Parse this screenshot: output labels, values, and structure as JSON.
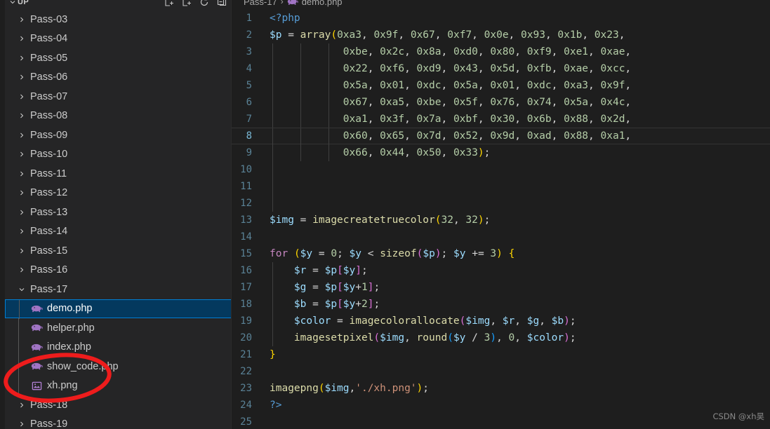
{
  "sidebar": {
    "header": {
      "title": "UP",
      "chevron_icon": "chevron-down-icon",
      "actions": [
        {
          "name": "new-file-icon",
          "tooltip": "New File"
        },
        {
          "name": "new-folder-icon",
          "tooltip": "New Folder"
        },
        {
          "name": "refresh-icon",
          "tooltip": "Refresh Explorer"
        },
        {
          "name": "collapse-all-icon",
          "tooltip": "Collapse Folders in Explorer"
        }
      ]
    },
    "tree": [
      {
        "label": "Pass-03",
        "type": "folder",
        "state": "collapsed"
      },
      {
        "label": "Pass-04",
        "type": "folder",
        "state": "collapsed"
      },
      {
        "label": "Pass-05",
        "type": "folder",
        "state": "collapsed"
      },
      {
        "label": "Pass-06",
        "type": "folder",
        "state": "collapsed"
      },
      {
        "label": "Pass-07",
        "type": "folder",
        "state": "collapsed"
      },
      {
        "label": "Pass-08",
        "type": "folder",
        "state": "collapsed"
      },
      {
        "label": "Pass-09",
        "type": "folder",
        "state": "collapsed"
      },
      {
        "label": "Pass-10",
        "type": "folder",
        "state": "collapsed"
      },
      {
        "label": "Pass-11",
        "type": "folder",
        "state": "collapsed"
      },
      {
        "label": "Pass-12",
        "type": "folder",
        "state": "collapsed"
      },
      {
        "label": "Pass-13",
        "type": "folder",
        "state": "collapsed"
      },
      {
        "label": "Pass-14",
        "type": "folder",
        "state": "collapsed"
      },
      {
        "label": "Pass-15",
        "type": "folder",
        "state": "collapsed"
      },
      {
        "label": "Pass-16",
        "type": "folder",
        "state": "collapsed"
      },
      {
        "label": "Pass-17",
        "type": "folder",
        "state": "expanded"
      },
      {
        "label": "demo.php",
        "type": "php-file",
        "selected": true
      },
      {
        "label": "helper.php",
        "type": "php-file",
        "selected": false
      },
      {
        "label": "index.php",
        "type": "php-file",
        "selected": false
      },
      {
        "label": "show_code.php",
        "type": "php-file",
        "selected": false
      },
      {
        "label": "xh.png",
        "type": "image-file",
        "selected": false
      },
      {
        "label": "Pass-18",
        "type": "folder",
        "state": "collapsed"
      },
      {
        "label": "Pass-19",
        "type": "folder",
        "state": "collapsed"
      }
    ]
  },
  "editor": {
    "breadcrumb": {
      "folder": "Pass-17",
      "separator": "›",
      "file": "demo.php",
      "file_icon": "php-elephant-icon"
    },
    "active_line": 8,
    "lines": [
      {
        "n": "1",
        "segs": [
          [
            "t-tag",
            "<?php"
          ]
        ]
      },
      {
        "n": "2",
        "segs": [
          [
            "t-var",
            "$p"
          ],
          [
            "t-op",
            " = "
          ],
          [
            "t-fn",
            "array"
          ],
          [
            "t-p1",
            "("
          ],
          [
            "t-num",
            "0xa3"
          ],
          [
            "t-op",
            ", "
          ],
          [
            "t-num",
            "0x9f"
          ],
          [
            "t-op",
            ", "
          ],
          [
            "t-num",
            "0x67"
          ],
          [
            "t-op",
            ", "
          ],
          [
            "t-num",
            "0xf7"
          ],
          [
            "t-op",
            ", "
          ],
          [
            "t-num",
            "0x0e"
          ],
          [
            "t-op",
            ", "
          ],
          [
            "t-num",
            "0x93"
          ],
          [
            "t-op",
            ", "
          ],
          [
            "t-num",
            "0x1b"
          ],
          [
            "t-op",
            ", "
          ],
          [
            "t-num",
            "0x23"
          ],
          [
            "t-op",
            ","
          ]
        ]
      },
      {
        "n": "3",
        "segs": [
          [
            "t-plain",
            "            "
          ],
          [
            "t-num",
            "0xbe"
          ],
          [
            "t-op",
            ", "
          ],
          [
            "t-num",
            "0x2c"
          ],
          [
            "t-op",
            ", "
          ],
          [
            "t-num",
            "0x8a"
          ],
          [
            "t-op",
            ", "
          ],
          [
            "t-num",
            "0xd0"
          ],
          [
            "t-op",
            ", "
          ],
          [
            "t-num",
            "0x80"
          ],
          [
            "t-op",
            ", "
          ],
          [
            "t-num",
            "0xf9"
          ],
          [
            "t-op",
            ", "
          ],
          [
            "t-num",
            "0xe1"
          ],
          [
            "t-op",
            ", "
          ],
          [
            "t-num",
            "0xae"
          ],
          [
            "t-op",
            ","
          ]
        ]
      },
      {
        "n": "4",
        "segs": [
          [
            "t-plain",
            "            "
          ],
          [
            "t-num",
            "0x22"
          ],
          [
            "t-op",
            ", "
          ],
          [
            "t-num",
            "0xf6"
          ],
          [
            "t-op",
            ", "
          ],
          [
            "t-num",
            "0xd9"
          ],
          [
            "t-op",
            ", "
          ],
          [
            "t-num",
            "0x43"
          ],
          [
            "t-op",
            ", "
          ],
          [
            "t-num",
            "0x5d"
          ],
          [
            "t-op",
            ", "
          ],
          [
            "t-num",
            "0xfb"
          ],
          [
            "t-op",
            ", "
          ],
          [
            "t-num",
            "0xae"
          ],
          [
            "t-op",
            ", "
          ],
          [
            "t-num",
            "0xcc"
          ],
          [
            "t-op",
            ","
          ]
        ]
      },
      {
        "n": "5",
        "segs": [
          [
            "t-plain",
            "            "
          ],
          [
            "t-num",
            "0x5a"
          ],
          [
            "t-op",
            ", "
          ],
          [
            "t-num",
            "0x01"
          ],
          [
            "t-op",
            ", "
          ],
          [
            "t-num",
            "0xdc"
          ],
          [
            "t-op",
            ", "
          ],
          [
            "t-num",
            "0x5a"
          ],
          [
            "t-op",
            ", "
          ],
          [
            "t-num",
            "0x01"
          ],
          [
            "t-op",
            ", "
          ],
          [
            "t-num",
            "0xdc"
          ],
          [
            "t-op",
            ", "
          ],
          [
            "t-num",
            "0xa3"
          ],
          [
            "t-op",
            ", "
          ],
          [
            "t-num",
            "0x9f"
          ],
          [
            "t-op",
            ","
          ]
        ]
      },
      {
        "n": "6",
        "segs": [
          [
            "t-plain",
            "            "
          ],
          [
            "t-num",
            "0x67"
          ],
          [
            "t-op",
            ", "
          ],
          [
            "t-num",
            "0xa5"
          ],
          [
            "t-op",
            ", "
          ],
          [
            "t-num",
            "0xbe"
          ],
          [
            "t-op",
            ", "
          ],
          [
            "t-num",
            "0x5f"
          ],
          [
            "t-op",
            ", "
          ],
          [
            "t-num",
            "0x76"
          ],
          [
            "t-op",
            ", "
          ],
          [
            "t-num",
            "0x74"
          ],
          [
            "t-op",
            ", "
          ],
          [
            "t-num",
            "0x5a"
          ],
          [
            "t-op",
            ", "
          ],
          [
            "t-num",
            "0x4c"
          ],
          [
            "t-op",
            ","
          ]
        ]
      },
      {
        "n": "7",
        "segs": [
          [
            "t-plain",
            "            "
          ],
          [
            "t-num",
            "0xa1"
          ],
          [
            "t-op",
            ", "
          ],
          [
            "t-num",
            "0x3f"
          ],
          [
            "t-op",
            ", "
          ],
          [
            "t-num",
            "0x7a"
          ],
          [
            "t-op",
            ", "
          ],
          [
            "t-num",
            "0xbf"
          ],
          [
            "t-op",
            ", "
          ],
          [
            "t-num",
            "0x30"
          ],
          [
            "t-op",
            ", "
          ],
          [
            "t-num",
            "0x6b"
          ],
          [
            "t-op",
            ", "
          ],
          [
            "t-num",
            "0x88"
          ],
          [
            "t-op",
            ", "
          ],
          [
            "t-num",
            "0x2d"
          ],
          [
            "t-op",
            ","
          ]
        ]
      },
      {
        "n": "8",
        "segs": [
          [
            "t-plain",
            "            "
          ],
          [
            "t-num",
            "0x60"
          ],
          [
            "t-op",
            ", "
          ],
          [
            "t-num",
            "0x65"
          ],
          [
            "t-op",
            ", "
          ],
          [
            "t-num",
            "0x7d"
          ],
          [
            "t-op",
            ", "
          ],
          [
            "t-num",
            "0x52"
          ],
          [
            "t-op",
            ", "
          ],
          [
            "t-num",
            "0x9d"
          ],
          [
            "t-op",
            ", "
          ],
          [
            "t-num",
            "0xad"
          ],
          [
            "t-op",
            ", "
          ],
          [
            "t-num",
            "0x88"
          ],
          [
            "t-op",
            ", "
          ],
          [
            "t-num",
            "0xa1"
          ],
          [
            "t-op",
            ","
          ]
        ]
      },
      {
        "n": "9",
        "segs": [
          [
            "t-plain",
            "            "
          ],
          [
            "t-num",
            "0x66"
          ],
          [
            "t-op",
            ", "
          ],
          [
            "t-num",
            "0x44"
          ],
          [
            "t-op",
            ", "
          ],
          [
            "t-num",
            "0x50"
          ],
          [
            "t-op",
            ", "
          ],
          [
            "t-num",
            "0x33"
          ],
          [
            "t-p1",
            ")"
          ],
          [
            "t-op",
            ";"
          ]
        ]
      },
      {
        "n": "10",
        "segs": []
      },
      {
        "n": "11",
        "segs": []
      },
      {
        "n": "12",
        "segs": []
      },
      {
        "n": "13",
        "segs": [
          [
            "t-var",
            "$img"
          ],
          [
            "t-op",
            " = "
          ],
          [
            "t-fn",
            "imagecreatetruecolor"
          ],
          [
            "t-p1",
            "("
          ],
          [
            "t-num",
            "32"
          ],
          [
            "t-op",
            ", "
          ],
          [
            "t-num",
            "32"
          ],
          [
            "t-p1",
            ")"
          ],
          [
            "t-op",
            ";"
          ]
        ]
      },
      {
        "n": "14",
        "segs": []
      },
      {
        "n": "15",
        "segs": [
          [
            "t-ctrl",
            "for"
          ],
          [
            "t-op",
            " "
          ],
          [
            "t-p1",
            "("
          ],
          [
            "t-var",
            "$y"
          ],
          [
            "t-op",
            " = "
          ],
          [
            "t-num",
            "0"
          ],
          [
            "t-op",
            "; "
          ],
          [
            "t-var",
            "$y"
          ],
          [
            "t-op",
            " < "
          ],
          [
            "t-fn",
            "sizeof"
          ],
          [
            "t-p2",
            "("
          ],
          [
            "t-var",
            "$p"
          ],
          [
            "t-p2",
            ")"
          ],
          [
            "t-op",
            "; "
          ],
          [
            "t-var",
            "$y"
          ],
          [
            "t-op",
            " += "
          ],
          [
            "t-num",
            "3"
          ],
          [
            "t-p1",
            ")"
          ],
          [
            "t-op",
            " "
          ],
          [
            "t-p1",
            "{"
          ]
        ]
      },
      {
        "n": "16",
        "segs": [
          [
            "t-plain",
            "    "
          ],
          [
            "t-var",
            "$r"
          ],
          [
            "t-op",
            " = "
          ],
          [
            "t-var",
            "$p"
          ],
          [
            "t-p2",
            "["
          ],
          [
            "t-var",
            "$y"
          ],
          [
            "t-p2",
            "]"
          ],
          [
            "t-op",
            ";"
          ]
        ]
      },
      {
        "n": "17",
        "segs": [
          [
            "t-plain",
            "    "
          ],
          [
            "t-var",
            "$g"
          ],
          [
            "t-op",
            " = "
          ],
          [
            "t-var",
            "$p"
          ],
          [
            "t-p2",
            "["
          ],
          [
            "t-var",
            "$y"
          ],
          [
            "t-op",
            "+"
          ],
          [
            "t-num",
            "1"
          ],
          [
            "t-p2",
            "]"
          ],
          [
            "t-op",
            ";"
          ]
        ]
      },
      {
        "n": "18",
        "segs": [
          [
            "t-plain",
            "    "
          ],
          [
            "t-var",
            "$b"
          ],
          [
            "t-op",
            " = "
          ],
          [
            "t-var",
            "$p"
          ],
          [
            "t-p2",
            "["
          ],
          [
            "t-var",
            "$y"
          ],
          [
            "t-op",
            "+"
          ],
          [
            "t-num",
            "2"
          ],
          [
            "t-p2",
            "]"
          ],
          [
            "t-op",
            ";"
          ]
        ]
      },
      {
        "n": "19",
        "segs": [
          [
            "t-plain",
            "    "
          ],
          [
            "t-var",
            "$color"
          ],
          [
            "t-op",
            " = "
          ],
          [
            "t-fn",
            "imagecolorallocate"
          ],
          [
            "t-p2",
            "("
          ],
          [
            "t-var",
            "$img"
          ],
          [
            "t-op",
            ", "
          ],
          [
            "t-var",
            "$r"
          ],
          [
            "t-op",
            ", "
          ],
          [
            "t-var",
            "$g"
          ],
          [
            "t-op",
            ", "
          ],
          [
            "t-var",
            "$b"
          ],
          [
            "t-p2",
            ")"
          ],
          [
            "t-op",
            ";"
          ]
        ]
      },
      {
        "n": "20",
        "segs": [
          [
            "t-plain",
            "    "
          ],
          [
            "t-fn",
            "imagesetpixel"
          ],
          [
            "t-p2",
            "("
          ],
          [
            "t-var",
            "$img"
          ],
          [
            "t-op",
            ", "
          ],
          [
            "t-fn",
            "round"
          ],
          [
            "t-p3",
            "("
          ],
          [
            "t-var",
            "$y"
          ],
          [
            "t-op",
            " / "
          ],
          [
            "t-num",
            "3"
          ],
          [
            "t-p3",
            ")"
          ],
          [
            "t-op",
            ", "
          ],
          [
            "t-num",
            "0"
          ],
          [
            "t-op",
            ", "
          ],
          [
            "t-var",
            "$color"
          ],
          [
            "t-p2",
            ")"
          ],
          [
            "t-op",
            ";"
          ]
        ]
      },
      {
        "n": "21",
        "segs": [
          [
            "t-p1",
            "}"
          ]
        ]
      },
      {
        "n": "22",
        "segs": []
      },
      {
        "n": "23",
        "segs": [
          [
            "t-fn",
            "imagepng"
          ],
          [
            "t-p1",
            "("
          ],
          [
            "t-var",
            "$img"
          ],
          [
            "t-op",
            ","
          ],
          [
            "t-str",
            "'./xh.png'"
          ],
          [
            "t-p1",
            ")"
          ],
          [
            "t-op",
            ";"
          ]
        ]
      },
      {
        "n": "24",
        "segs": [
          [
            "t-tag",
            "?>"
          ]
        ]
      },
      {
        "n": "25",
        "segs": []
      }
    ]
  },
  "watermark": {
    "text": "CSDN @xh昊"
  },
  "annotation": {
    "shape": "ellipse",
    "color": "#ee1c1c",
    "target": "xh.png"
  },
  "colors": {
    "editor_bg": "#1e1e1e",
    "sidebar_bg": "#252526",
    "selection_bg": "#04395e",
    "selection_border": "#007fd4",
    "line_number": "#5a8296",
    "text": "#d4d4d4",
    "annotation_red": "#ee1c1c"
  }
}
